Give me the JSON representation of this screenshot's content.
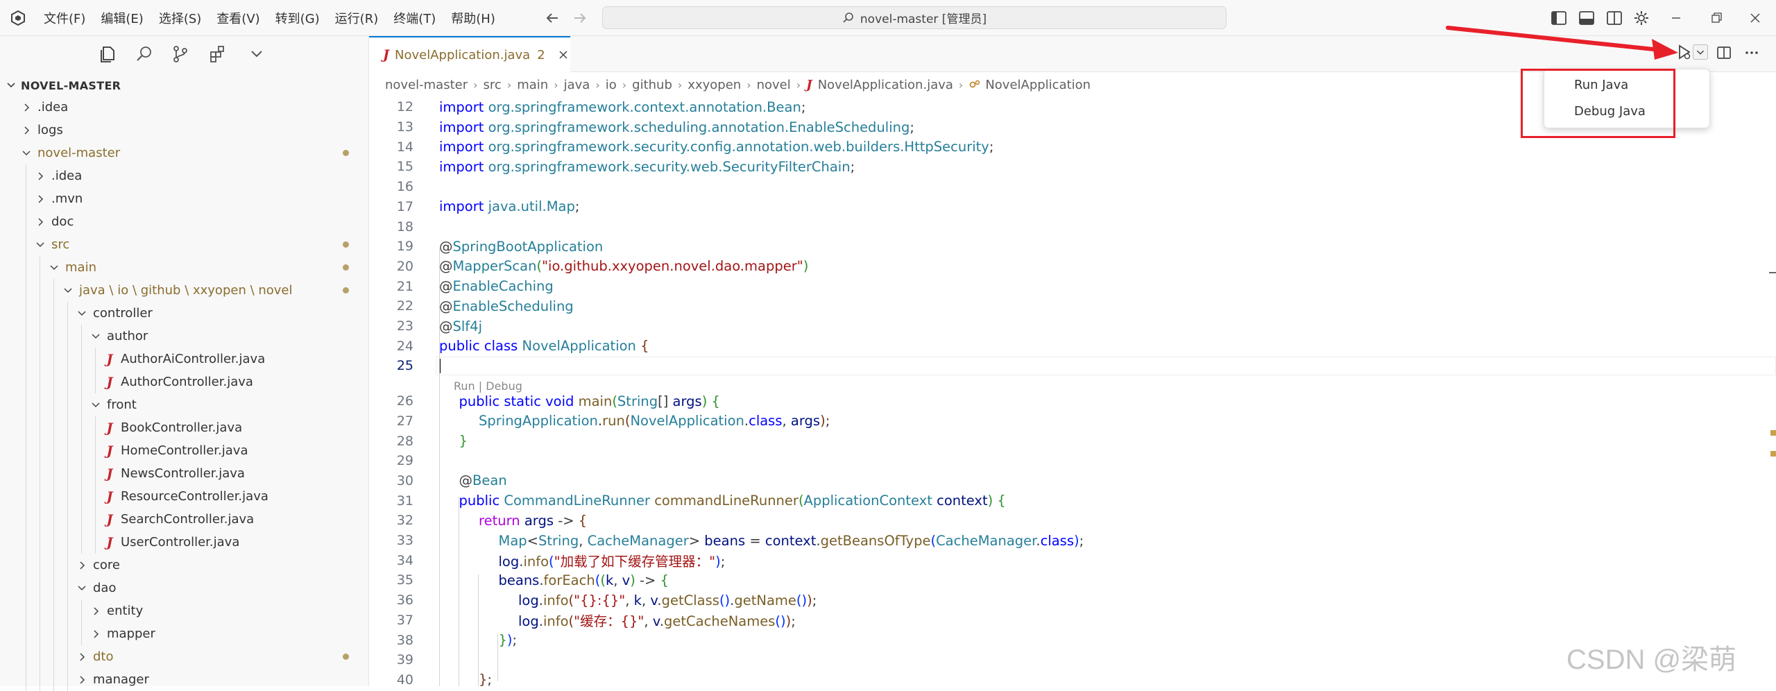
{
  "menubar": [
    "文件(F)",
    "编辑(E)",
    "选择(S)",
    "查看(V)",
    "转到(G)",
    "运行(R)",
    "终端(T)",
    "帮助(H)"
  ],
  "command_center": {
    "label": "novel-master [管理员]"
  },
  "explorer": {
    "root_title": "NOVEL-MASTER",
    "tree": [
      {
        "label": ".idea",
        "kind": "folder",
        "depth": 0,
        "open": false,
        "modified": false
      },
      {
        "label": "logs",
        "kind": "folder",
        "depth": 0,
        "open": false,
        "modified": false
      },
      {
        "label": "novel-master",
        "kind": "folder",
        "depth": 0,
        "open": true,
        "modified": true
      },
      {
        "label": ".idea",
        "kind": "folder",
        "depth": 1,
        "open": false,
        "modified": false
      },
      {
        "label": ".mvn",
        "kind": "folder",
        "depth": 1,
        "open": false,
        "modified": false
      },
      {
        "label": "doc",
        "kind": "folder",
        "depth": 1,
        "open": false,
        "modified": false
      },
      {
        "label": "src",
        "kind": "folder",
        "depth": 1,
        "open": true,
        "modified": true
      },
      {
        "label": "main",
        "kind": "folder",
        "depth": 2,
        "open": true,
        "modified": true
      },
      {
        "label": "java \\ io \\ github \\ xxyopen \\ novel",
        "kind": "folder",
        "depth": 3,
        "open": true,
        "modified": true
      },
      {
        "label": "controller",
        "kind": "folder",
        "depth": 4,
        "open": true,
        "modified": false
      },
      {
        "label": "author",
        "kind": "folder",
        "depth": 5,
        "open": true,
        "modified": false
      },
      {
        "label": "AuthorAiController.java",
        "kind": "java",
        "depth": 6,
        "open": false,
        "modified": false
      },
      {
        "label": "AuthorController.java",
        "kind": "java",
        "depth": 6,
        "open": false,
        "modified": false
      },
      {
        "label": "front",
        "kind": "folder",
        "depth": 5,
        "open": true,
        "modified": false
      },
      {
        "label": "BookController.java",
        "kind": "java",
        "depth": 6,
        "open": false,
        "modified": false
      },
      {
        "label": "HomeController.java",
        "kind": "java",
        "depth": 6,
        "open": false,
        "modified": false
      },
      {
        "label": "NewsController.java",
        "kind": "java",
        "depth": 6,
        "open": false,
        "modified": false
      },
      {
        "label": "ResourceController.java",
        "kind": "java",
        "depth": 6,
        "open": false,
        "modified": false
      },
      {
        "label": "SearchController.java",
        "kind": "java",
        "depth": 6,
        "open": false,
        "modified": false
      },
      {
        "label": "UserController.java",
        "kind": "java",
        "depth": 6,
        "open": false,
        "modified": false
      },
      {
        "label": "core",
        "kind": "folder",
        "depth": 4,
        "open": false,
        "modified": false
      },
      {
        "label": "dao",
        "kind": "folder",
        "depth": 4,
        "open": true,
        "modified": false
      },
      {
        "label": "entity",
        "kind": "folder",
        "depth": 5,
        "open": false,
        "modified": false
      },
      {
        "label": "mapper",
        "kind": "folder",
        "depth": 5,
        "open": false,
        "modified": false
      },
      {
        "label": "dto",
        "kind": "folder",
        "depth": 4,
        "open": false,
        "modified": true
      },
      {
        "label": "manager",
        "kind": "folder",
        "depth": 4,
        "open": false,
        "modified": false
      }
    ]
  },
  "tab": {
    "label": "NovelApplication.java",
    "badge": "2"
  },
  "breadcrumb": [
    "novel-master",
    "src",
    "main",
    "java",
    "io",
    "github",
    "xxyopen",
    "novel",
    "NovelApplication.java",
    "NovelApplication"
  ],
  "run_menu": {
    "items": [
      "Run Java",
      "Debug Java"
    ]
  },
  "codelens": "Run | Debug",
  "code": [
    {
      "n": "12",
      "indent": 0,
      "tokens": [
        [
          "k",
          "import "
        ],
        [
          "t",
          "org.springframework.context.annotation.Bean"
        ],
        [
          "p",
          ";"
        ]
      ]
    },
    {
      "n": "13",
      "indent": 0,
      "tokens": [
        [
          "k",
          "import "
        ],
        [
          "t",
          "org.springframework.scheduling.annotation.EnableScheduling"
        ],
        [
          "p",
          ";"
        ]
      ]
    },
    {
      "n": "14",
      "indent": 0,
      "tokens": [
        [
          "k",
          "import "
        ],
        [
          "t",
          "org.springframework.security.config.annotation.web.builders.HttpSecurity"
        ],
        [
          "p",
          ";"
        ]
      ]
    },
    {
      "n": "15",
      "indent": 0,
      "tokens": [
        [
          "k",
          "import "
        ],
        [
          "t",
          "org.springframework.security.web.SecurityFilterChain"
        ],
        [
          "p",
          ";"
        ]
      ]
    },
    {
      "n": "16",
      "indent": 0,
      "tokens": []
    },
    {
      "n": "17",
      "indent": 0,
      "tokens": [
        [
          "k",
          "import "
        ],
        [
          "t",
          "java.util.Map"
        ],
        [
          "p",
          ";"
        ]
      ]
    },
    {
      "n": "18",
      "indent": 0,
      "tokens": []
    },
    {
      "n": "19",
      "indent": 0,
      "tokens": [
        [
          "p",
          "@"
        ],
        [
          "t",
          "SpringBootApplication"
        ]
      ]
    },
    {
      "n": "20",
      "indent": 0,
      "tokens": [
        [
          "p",
          "@"
        ],
        [
          "t",
          "MapperScan"
        ],
        [
          "b2",
          "("
        ],
        [
          "s",
          "\"io.github.xxyopen.novel.dao.mapper\""
        ],
        [
          "b2",
          ")"
        ]
      ]
    },
    {
      "n": "21",
      "indent": 0,
      "tokens": [
        [
          "p",
          "@"
        ],
        [
          "t",
          "EnableCaching"
        ]
      ]
    },
    {
      "n": "22",
      "indent": 0,
      "tokens": [
        [
          "p",
          "@"
        ],
        [
          "t",
          "EnableScheduling"
        ]
      ]
    },
    {
      "n": "23",
      "indent": 0,
      "tokens": [
        [
          "p",
          "@"
        ],
        [
          "t",
          "Slf4j"
        ]
      ]
    },
    {
      "n": "24",
      "indent": 0,
      "tokens": [
        [
          "k",
          "public class "
        ],
        [
          "t",
          "NovelApplication "
        ],
        [
          "b3",
          "{"
        ]
      ]
    },
    {
      "n": "25",
      "indent": 0,
      "tokens": [],
      "current": true
    },
    {
      "n": "26",
      "indent": 1,
      "tokens": [
        [
          "k",
          "public static void "
        ],
        [
          "f",
          "main"
        ],
        [
          "b2",
          "("
        ],
        [
          "t",
          "String"
        ],
        [
          "p",
          "[] "
        ],
        [
          "v",
          "args"
        ],
        [
          "b2",
          ")"
        ],
        [
          "p",
          " "
        ],
        [
          "b2",
          "{"
        ]
      ]
    },
    {
      "n": "27",
      "indent": 2,
      "tokens": [
        [
          "t",
          "SpringApplication"
        ],
        [
          "p",
          "."
        ],
        [
          "f",
          "run"
        ],
        [
          "b3",
          "("
        ],
        [
          "t",
          "NovelApplication"
        ],
        [
          "p",
          "."
        ],
        [
          "k",
          "class"
        ],
        [
          "p",
          ", "
        ],
        [
          "v",
          "args"
        ],
        [
          "b3",
          ")"
        ],
        [
          "p",
          ";"
        ]
      ]
    },
    {
      "n": "28",
      "indent": 1,
      "tokens": [
        [
          "b2",
          "}"
        ]
      ]
    },
    {
      "n": "29",
      "indent": 0,
      "tokens": []
    },
    {
      "n": "30",
      "indent": 1,
      "tokens": [
        [
          "p",
          "@"
        ],
        [
          "t",
          "Bean"
        ]
      ]
    },
    {
      "n": "31",
      "indent": 1,
      "tokens": [
        [
          "k",
          "public "
        ],
        [
          "t",
          "CommandLineRunner "
        ],
        [
          "f",
          "commandLineRunner"
        ],
        [
          "b2",
          "("
        ],
        [
          "t",
          "ApplicationContext "
        ],
        [
          "v",
          "context"
        ],
        [
          "b2",
          ")"
        ],
        [
          "p",
          " "
        ],
        [
          "b2",
          "{"
        ]
      ]
    },
    {
      "n": "32",
      "indent": 2,
      "tokens": [
        [
          "kc",
          "return "
        ],
        [
          "v",
          "args"
        ],
        [
          "p",
          " -> "
        ],
        [
          "b3",
          "{"
        ]
      ]
    },
    {
      "n": "33",
      "indent": 3,
      "tokens": [
        [
          "t",
          "Map"
        ],
        [
          "p",
          "<"
        ],
        [
          "t",
          "String"
        ],
        [
          "p",
          ", "
        ],
        [
          "t",
          "CacheManager"
        ],
        [
          "p",
          "> "
        ],
        [
          "v",
          "beans"
        ],
        [
          "p",
          " = "
        ],
        [
          "v",
          "context"
        ],
        [
          "p",
          "."
        ],
        [
          "f",
          "getBeansOfType"
        ],
        [
          "b1",
          "("
        ],
        [
          "t",
          "CacheManager"
        ],
        [
          "p",
          "."
        ],
        [
          "k",
          "class"
        ],
        [
          "b1",
          ")"
        ],
        [
          "p",
          ";"
        ]
      ]
    },
    {
      "n": "34",
      "indent": 3,
      "tokens": [
        [
          "v",
          "log"
        ],
        [
          "p",
          "."
        ],
        [
          "f",
          "info"
        ],
        [
          "b1",
          "("
        ],
        [
          "s",
          "\"加载了如下缓存管理器：\""
        ],
        [
          "b1",
          ")"
        ],
        [
          "p",
          ";"
        ]
      ]
    },
    {
      "n": "35",
      "indent": 3,
      "tokens": [
        [
          "v",
          "beans"
        ],
        [
          "p",
          "."
        ],
        [
          "f",
          "forEach"
        ],
        [
          "b1",
          "("
        ],
        [
          "b2",
          "("
        ],
        [
          "v",
          "k"
        ],
        [
          "p",
          ", "
        ],
        [
          "v",
          "v"
        ],
        [
          "b2",
          ")"
        ],
        [
          "p",
          " -> "
        ],
        [
          "b2",
          "{"
        ]
      ]
    },
    {
      "n": "36",
      "indent": 4,
      "tokens": [
        [
          "v",
          "log"
        ],
        [
          "p",
          "."
        ],
        [
          "f",
          "info"
        ],
        [
          "b3",
          "("
        ],
        [
          "s",
          "\"{}:{}\""
        ],
        [
          "p",
          ", "
        ],
        [
          "v",
          "k"
        ],
        [
          "p",
          ", "
        ],
        [
          "v",
          "v"
        ],
        [
          "p",
          "."
        ],
        [
          "f",
          "getClass"
        ],
        [
          "b1",
          "()"
        ],
        [
          "p",
          "."
        ],
        [
          "f",
          "getName"
        ],
        [
          "b1",
          "()"
        ],
        [
          "b3",
          ")"
        ],
        [
          "p",
          ";"
        ]
      ]
    },
    {
      "n": "37",
      "indent": 4,
      "tokens": [
        [
          "v",
          "log"
        ],
        [
          "p",
          "."
        ],
        [
          "f",
          "info"
        ],
        [
          "b3",
          "("
        ],
        [
          "s",
          "\"缓存：{}\""
        ],
        [
          "p",
          ", "
        ],
        [
          "v",
          "v"
        ],
        [
          "p",
          "."
        ],
        [
          "f",
          "getCacheNames"
        ],
        [
          "b1",
          "()"
        ],
        [
          "b3",
          ")"
        ],
        [
          "p",
          ";"
        ]
      ]
    },
    {
      "n": "38",
      "indent": 3,
      "tokens": [
        [
          "b2",
          "}"
        ],
        [
          "b1",
          ")"
        ],
        [
          "p",
          ";"
        ]
      ]
    },
    {
      "n": "39",
      "indent": 0,
      "tokens": []
    },
    {
      "n": "40",
      "indent": 2,
      "tokens": [
        [
          "b3",
          "}"
        ],
        [
          "p",
          ";"
        ]
      ]
    }
  ],
  "watermark": "CSDN @梁萌",
  "colors": {
    "accent": "#0078d4",
    "highlight_red": "#e8202a",
    "modified": "#b8a06a",
    "java_icon": "#c5252c"
  }
}
